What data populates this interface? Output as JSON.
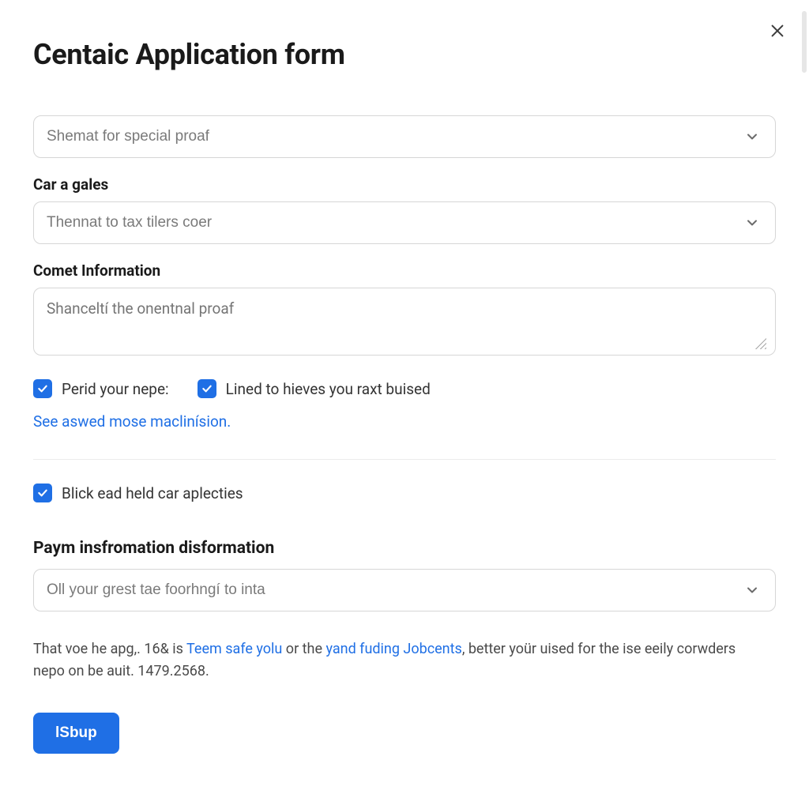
{
  "title": "Centaic Application form",
  "close_icon": "close-icon",
  "select1": {
    "placeholder": "Shemat for special proaf"
  },
  "section_car": {
    "label": "Car a gales",
    "select_placeholder": "Thennat to tax tilers coer"
  },
  "section_comet": {
    "label": "Comet Information",
    "textarea_placeholder": "Shanceltí the onentnal proaf"
  },
  "checks_row": {
    "c1_label": "Perid your nepe:",
    "c2_label": "Lined to hieves you raxt buised"
  },
  "more_link": "See aswed mose maclinísion.",
  "single_check_label": "Blick ead held car aplecties",
  "section_paym": {
    "heading": "Paym insfromation disformation",
    "select_placeholder": "Oll your grest tae foorhngí to inta"
  },
  "legal": {
    "t1": "That voe he apg,. 16& is ",
    "link1": "Teem safe yolu",
    "t2": " or the ",
    "link2": "yand fuding Jobcents",
    "t3": ", better yoür uised for the ise eeily corwders nepo on be auit. 1479.2568."
  },
  "submit_label": "lSbup"
}
